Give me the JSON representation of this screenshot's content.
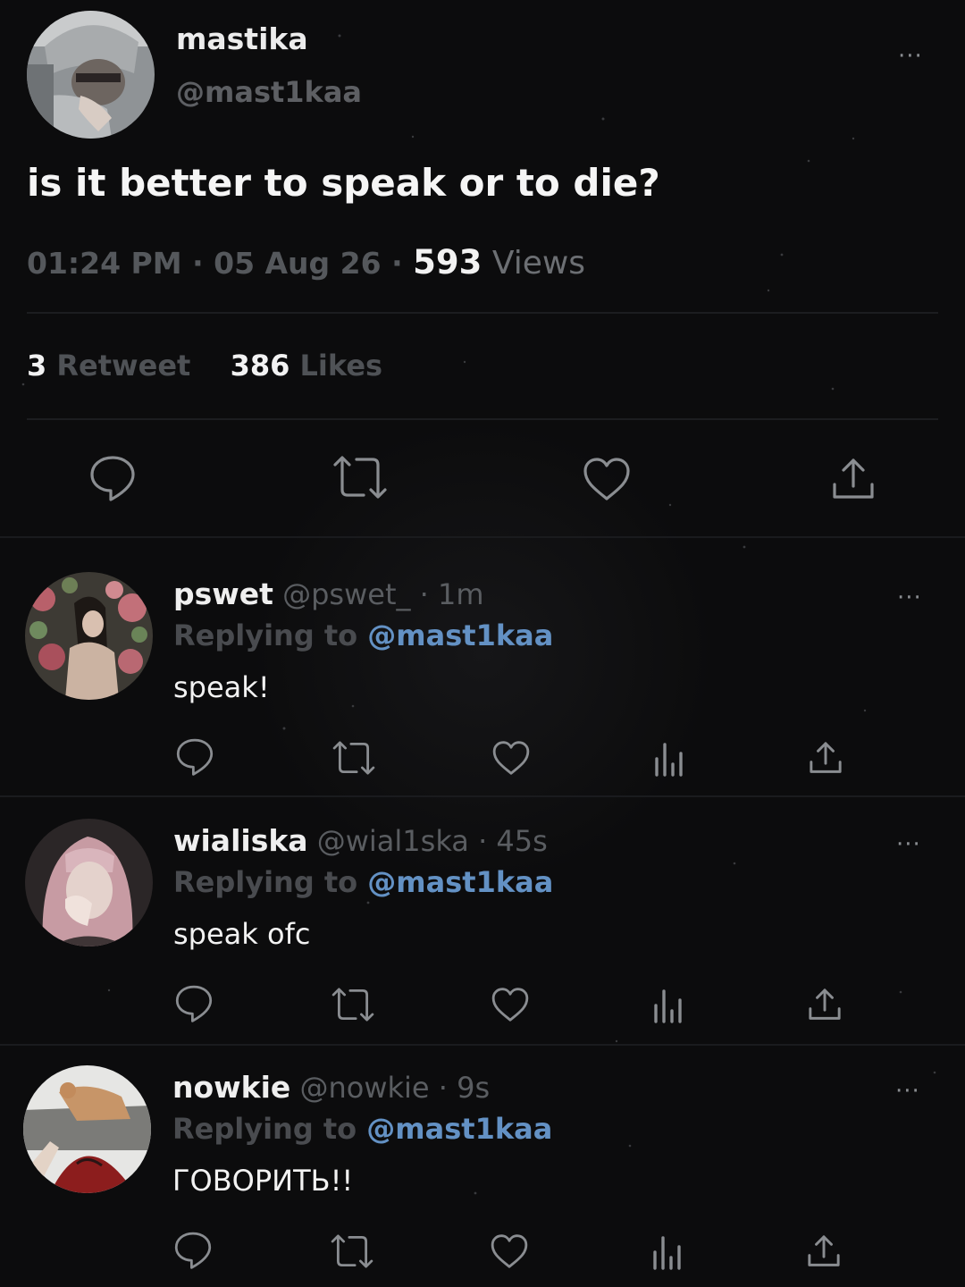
{
  "tweet": {
    "display_name": "mastika",
    "handle": "@mast1kaa",
    "text": "is it better to speak or to die?",
    "time": "01:24 PM",
    "date": "05 Aug 26",
    "views_count": "593",
    "views_label": "Views",
    "retweet_count": "3",
    "retweet_label": "Retweet",
    "likes_count": "386",
    "likes_label": "Likes",
    "more_icon": "···"
  },
  "replies": [
    {
      "display_name": "pswet",
      "handle": "@pswet_",
      "time": "1m",
      "replying_label": "Replying to",
      "mention": "@mast1kaa",
      "text": "speak!",
      "more_icon": "···"
    },
    {
      "display_name": "wialiska",
      "handle": "@wial1ska",
      "time": "45s",
      "replying_label": "Replying to",
      "mention": "@mast1kaa",
      "text": "speak ofc",
      "more_icon": "···"
    },
    {
      "display_name": "nowkie",
      "handle": "@nowkie",
      "time": "9s",
      "replying_label": "Replying to",
      "mention": "@mast1kaa",
      "text": "ГОВОРИТЬ!!",
      "more_icon": "···"
    }
  ],
  "separator": "·",
  "colors": {
    "background": "#0c0c0d",
    "mention": "#6391c4",
    "icon": "#8a8d91"
  },
  "icons": [
    "reply-icon",
    "retweet-icon",
    "like-icon",
    "views-icon",
    "share-icon",
    "more-icon"
  ]
}
